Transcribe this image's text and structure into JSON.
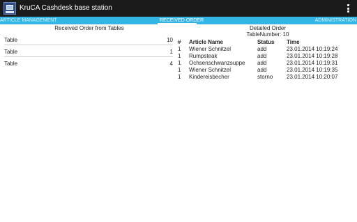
{
  "app": {
    "title": "KruCA Cashdesk base station",
    "icon": "cashdesk-monitor-icon"
  },
  "tabs": [
    {
      "label": "ARTICLE MANAGEMENT"
    },
    {
      "label": "RECEIVED ORDER"
    },
    {
      "label": "ADMINISTRATION"
    }
  ],
  "left": {
    "title": "Received Order from Tables",
    "tables": [
      {
        "label": "Table",
        "count": "10"
      },
      {
        "label": "Table",
        "count": "1"
      },
      {
        "label": "Table",
        "count": "4"
      }
    ]
  },
  "right": {
    "title": "Detailed Order",
    "subtitle": "TableNumber: 10",
    "columns": {
      "num": "#",
      "name": "Article Name",
      "status": "Status",
      "time": "Time"
    },
    "rows": [
      {
        "num": "1",
        "name": "Wiener Schnitzel",
        "status": "add",
        "time": "23.01.2014 10:19:24"
      },
      {
        "num": "1",
        "name": "Rumpsteak",
        "status": "add",
        "time": "23.01.2014 10:19:28"
      },
      {
        "num": "1",
        "name": "Ochsenschwanzsuppe",
        "status": "add",
        "time": "23.01.2014 10:19:31"
      },
      {
        "num": "1",
        "name": "Wiener Schnitzel",
        "status": "add",
        "time": "23.01.2014 10:19:35"
      },
      {
        "num": "1",
        "name": "Kindereisbecher",
        "status": "storno",
        "time": "23.01.2014 10:20:07"
      }
    ]
  },
  "colors": {
    "actionbar": "#1b1b1b",
    "tabbar": "#33b5e5",
    "divider": "#cfcfcf"
  }
}
